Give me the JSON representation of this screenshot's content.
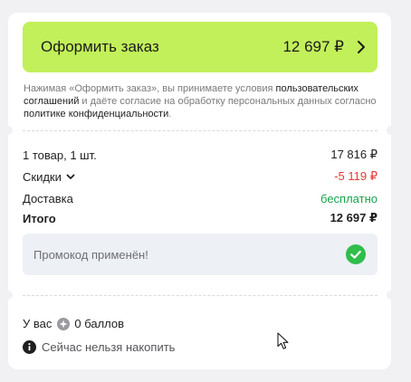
{
  "order_button": {
    "label": "Оформить заказ",
    "total": "12 697 ₽"
  },
  "disclaimer": {
    "part1": "Нажимая «Оформить заказ», вы принимаете условия ",
    "link1": "пользовательских соглашений",
    "part2": " и даёте согласие на обработку персональных данных согласно ",
    "link2": "политике конфиденциальности",
    "part3": "."
  },
  "summary": {
    "items": {
      "label": "1 товар, 1 шт.",
      "value": "17 816 ₽"
    },
    "discounts": {
      "label": "Скидки",
      "value": "-5 119 ₽"
    },
    "delivery": {
      "label": "Доставка",
      "value": "бесплатно"
    },
    "total": {
      "label": "Итого",
      "value": "12 697 ₽"
    }
  },
  "promo": {
    "text": "Промокод применён!"
  },
  "bonus": {
    "prefix": "У вас",
    "points": "0 баллов",
    "note": "Сейчас нельзя накопить"
  },
  "colors": {
    "accent": "#c2f05a",
    "discount": "#e53935",
    "free": "#17a34a",
    "success": "#2fbe4b"
  },
  "icons": [
    "chevron-right-icon",
    "chevron-down-icon",
    "check-circle-icon",
    "bonus-coin-icon",
    "info-icon",
    "mouse-cursor-icon"
  ]
}
